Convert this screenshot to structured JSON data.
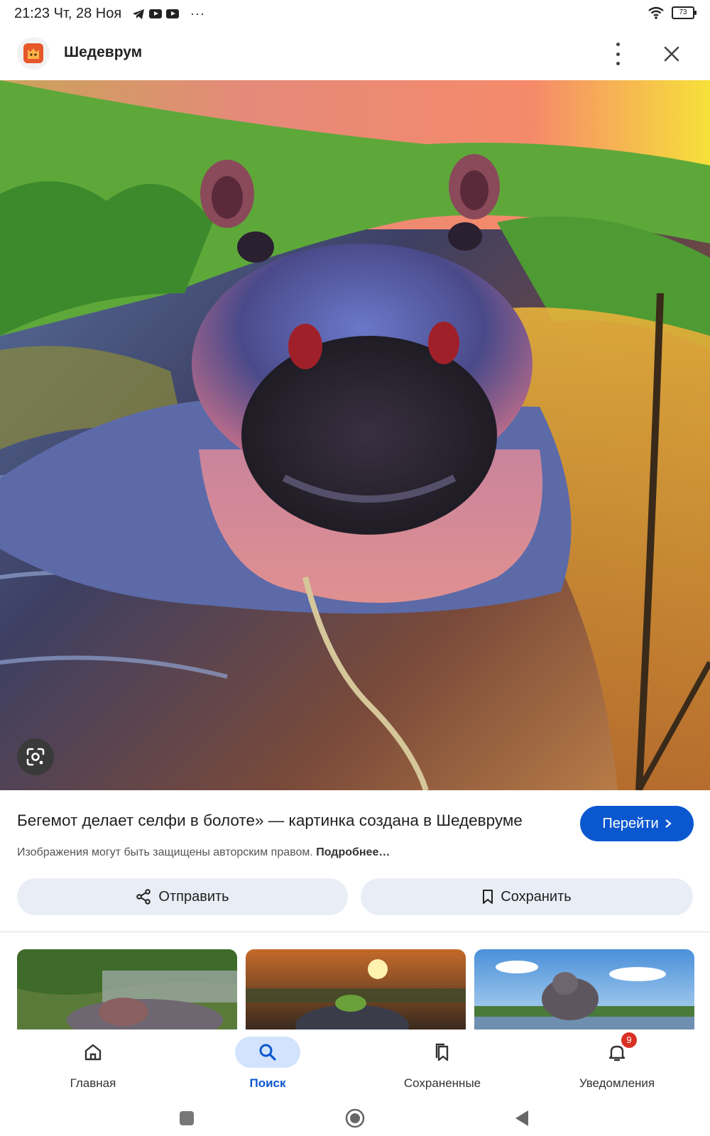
{
  "status_bar": {
    "time": "21:23 Чт, 28 Ноя",
    "more": "···",
    "battery": "73"
  },
  "app_bar": {
    "title": "Шедеврум"
  },
  "result": {
    "title": "Бегемот делает селфи в болоте» — картинка создана в Шедевруме",
    "visit_label": "Перейти",
    "copyright_text": "Изображения могут быть защищены авторским правом.",
    "copyright_link": "Подробнее…"
  },
  "actions": {
    "share_label": "Отправить",
    "save_label": "Сохранить"
  },
  "bottom_nav": {
    "items": [
      {
        "label": "Главная",
        "icon": "home-icon"
      },
      {
        "label": "Поиск",
        "icon": "search-icon",
        "active": true
      },
      {
        "label": "Сохраненные",
        "icon": "bookmarks-icon"
      },
      {
        "label": "Уведомления",
        "icon": "bell-icon",
        "badge": "9"
      }
    ]
  },
  "colors": {
    "accent": "#0b57d0",
    "chip_bg": "#e9eef6",
    "active_nav_bg": "#d3e3fd",
    "badge": "#d93025"
  }
}
